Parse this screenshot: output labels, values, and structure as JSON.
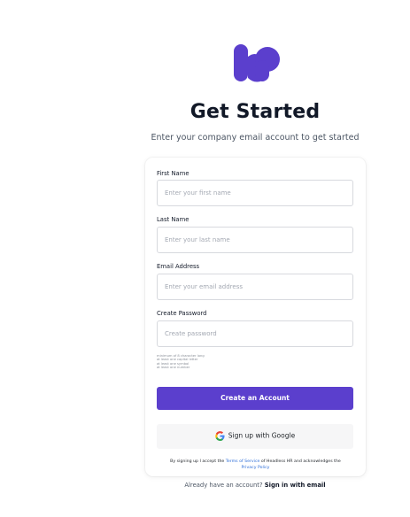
{
  "brand": {
    "logo_name": "hr-logo",
    "accent": "#5b3fcd"
  },
  "header": {
    "title": "Get Started",
    "subtitle": "Enter your company email account to get started"
  },
  "form": {
    "first_name": {
      "label": "First Name",
      "placeholder": "Enter your first name",
      "value": ""
    },
    "last_name": {
      "label": "Last Name",
      "placeholder": "Enter your last name",
      "value": ""
    },
    "email": {
      "label": "Email Address",
      "placeholder": "Enter your email address",
      "value": ""
    },
    "password": {
      "label": "Create Password",
      "placeholder": "Create password",
      "value": ""
    },
    "password_hints": [
      "minimum of 8 character long",
      "at least one capital letter",
      "at least one symbol",
      "at least one number"
    ],
    "submit_label": "Create an Account",
    "google_label": "Sign up with Google",
    "terms": {
      "prefix": "By signing up I accept the ",
      "tos_link": "Terms of Service",
      "middle": " of Headless HR and acknowledges the ",
      "privacy_link": "Privacy Policy"
    }
  },
  "footer": {
    "prompt": "Already have an account? ",
    "signin_link": "Sign in with email"
  }
}
